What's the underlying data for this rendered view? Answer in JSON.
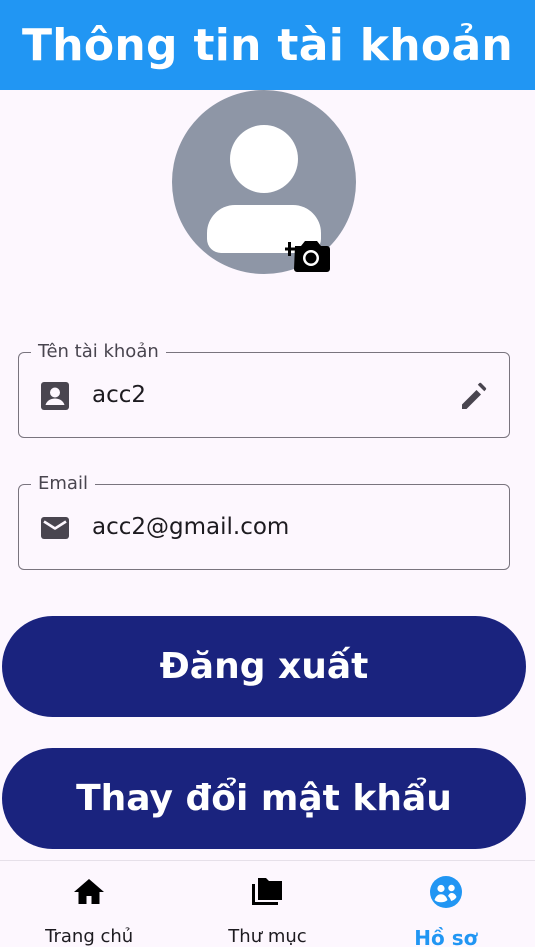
{
  "app_bar": {
    "title": "Thông tin tài khoản",
    "color": "#2196f3"
  },
  "avatar": {
    "icon": "account-circle-icon",
    "camera_icon": "add-a-photo-icon"
  },
  "fields": {
    "username": {
      "label": "Tên tài khoản",
      "value": "acc2",
      "icon": "contact-card-icon",
      "action_icon": "edit-pencil-icon"
    },
    "email": {
      "label": "Email",
      "value": "acc2@gmail.com",
      "icon": "mail-icon"
    }
  },
  "buttons": {
    "logout": "Đăng xuất",
    "change_password": "Thay đổi mật khẩu",
    "color": "#1a237e"
  },
  "bottom_nav": {
    "items": [
      {
        "label": "Trang chủ",
        "icon": "home-icon",
        "active": false
      },
      {
        "label": "Thư mục",
        "icon": "folder-icon",
        "active": false
      },
      {
        "label": "Hồ sơ",
        "icon": "profile-icon",
        "active": true
      }
    ],
    "active_color": "#2196f3"
  }
}
